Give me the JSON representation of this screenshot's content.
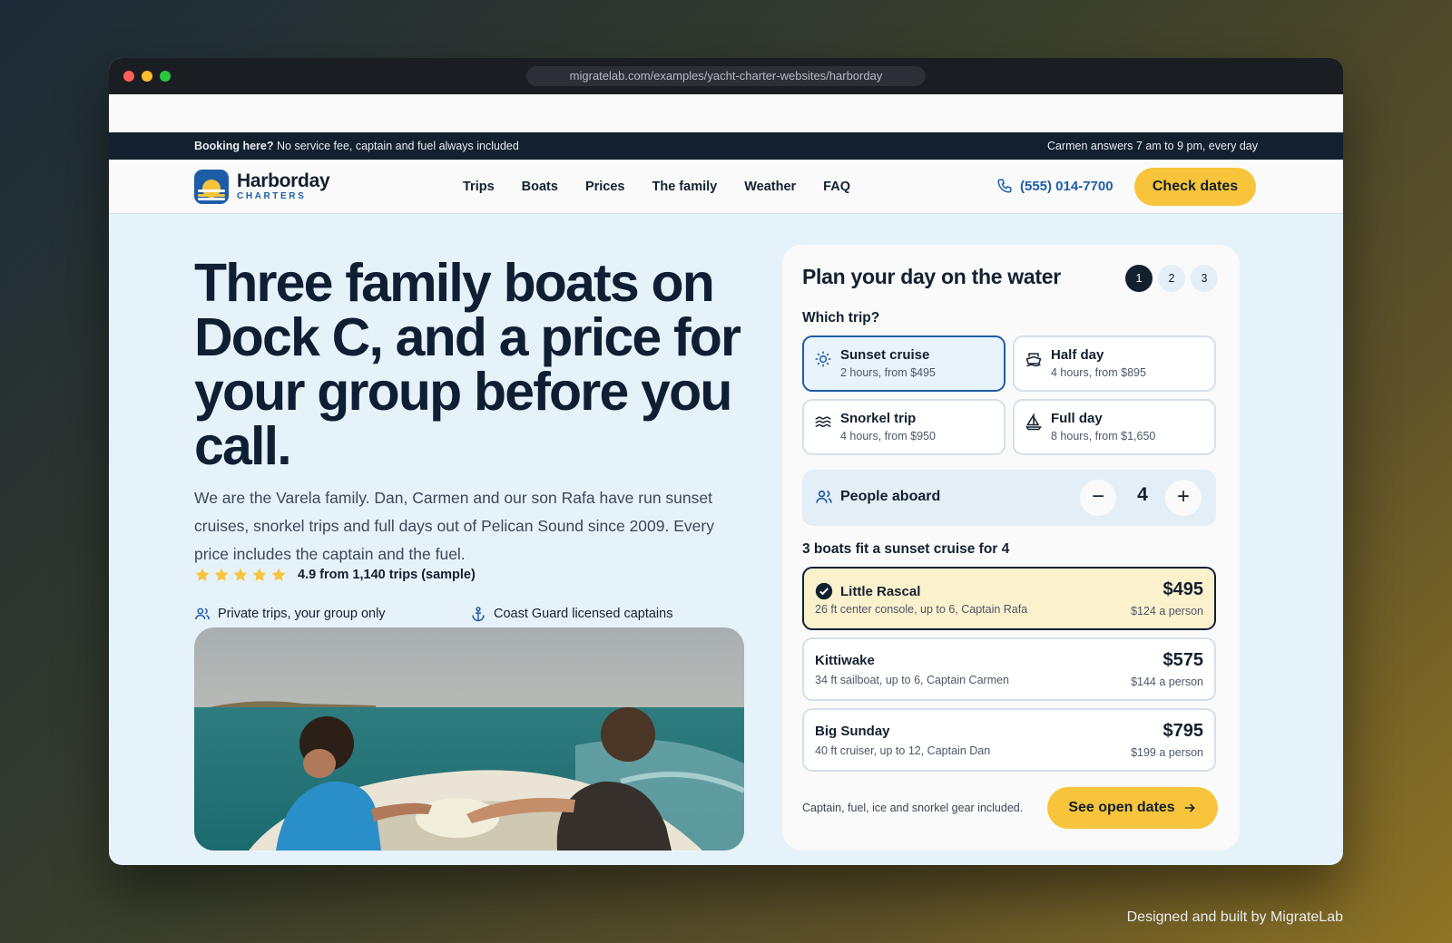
{
  "browser": {
    "url": "migratelab.com/examples/yacht-charter-websites/harborday"
  },
  "topbar": {
    "left_bold": "Booking here?",
    "left_text": "No service fee, captain and fuel always included",
    "right_text": "Carmen answers 7 am to 9 pm, every day"
  },
  "brand": {
    "name": "Harborday",
    "sub": "CHARTERS"
  },
  "nav": {
    "items": [
      "Trips",
      "Boats",
      "Prices",
      "The family",
      "Weather",
      "FAQ"
    ],
    "phone": "(555) 014-7700",
    "cta": "Check dates"
  },
  "hero": {
    "title": "Three family boats on Dock C, and a price for your group before you call.",
    "paragraph": "We are the Varela family. Dan, Carmen and our son Rafa have run sunset cruises, snorkel trips and full days out of Pelican Sound since 2009. Every price includes the captain and the fuel.",
    "rating_stars": 5,
    "rating_text": "4.9 from 1,140 trips (sample)",
    "feature_1": "Private trips, your group only",
    "feature_2": "Coast Guard licensed captains"
  },
  "planner": {
    "title": "Plan your day on the water",
    "steps": [
      "1",
      "2",
      "3"
    ],
    "active_step": 1,
    "trip_label": "Which trip?",
    "trips": [
      {
        "name": "Sunset cruise",
        "detail": "2 hours, from $495",
        "icon": "sun-icon",
        "selected": true
      },
      {
        "name": "Half day",
        "detail": "4 hours, from $895",
        "icon": "boat-icon",
        "selected": false
      },
      {
        "name": "Snorkel trip",
        "detail": "4 hours, from $950",
        "icon": "waves-icon",
        "selected": false
      },
      {
        "name": "Full day",
        "detail": "8 hours, from $1,650",
        "icon": "sailboat-icon",
        "selected": false
      }
    ],
    "people_label": "People aboard",
    "people_count": "4",
    "boats_heading": "3 boats fit a sunset cruise for 4",
    "boats": [
      {
        "name": "Little Rascal",
        "detail": "26 ft center console, up to 6, Captain Rafa",
        "price": "$495",
        "per_person": "$124 a person",
        "selected": true
      },
      {
        "name": "Kittiwake",
        "detail": "34 ft sailboat, up to 6, Captain Carmen",
        "price": "$575",
        "per_person": "$144 a person",
        "selected": false
      },
      {
        "name": "Big Sunday",
        "detail": "40 ft cruiser, up to 12, Captain Dan",
        "price": "$795",
        "per_person": "$199 a person",
        "selected": false
      }
    ],
    "footer_note": "Captain, fuel, ice and snorkel gear included.",
    "cta": "See open dates"
  },
  "credit": "Designed and built by MigrateLab",
  "colors": {
    "navy": "#13202f",
    "blue": "#1d5da8",
    "yellow": "#f7c43b",
    "hero_bg": "#e6f2fa"
  }
}
